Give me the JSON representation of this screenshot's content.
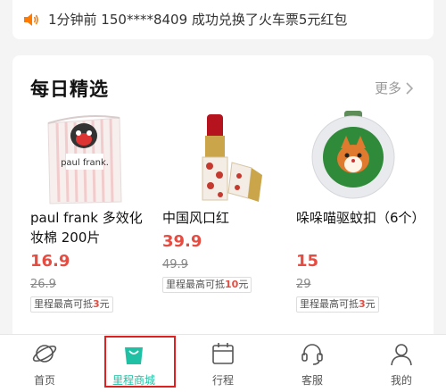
{
  "notice": {
    "text": "1分钟前 150****8409 成功兑换了火车票5元红包"
  },
  "section": {
    "title": "每日精选",
    "more": "更多"
  },
  "products": [
    {
      "name": "paul frank 多效化妆棉 200片",
      "price": "16.9",
      "original_price": "26.9",
      "tag_prefix": "里程最高可抵",
      "tag_amount": "3",
      "tag_suffix": "元",
      "image_brand": "paul frank."
    },
    {
      "name": "中国风口红",
      "price": "39.9",
      "original_price": "49.9",
      "tag_prefix": "里程最高可抵",
      "tag_amount": "10",
      "tag_suffix": "元"
    },
    {
      "name": "哚哚喵驱蚊扣（6个）",
      "price": "15",
      "original_price": "29",
      "tag_prefix": "里程最高可抵",
      "tag_amount": "3",
      "tag_suffix": "元"
    }
  ],
  "tabs": [
    {
      "label": "首页",
      "icon": "home-planet-icon"
    },
    {
      "label": "里程商城",
      "icon": "shopping-bag-icon",
      "active": true
    },
    {
      "label": "行程",
      "icon": "calendar-icon"
    },
    {
      "label": "客服",
      "icon": "headset-icon"
    },
    {
      "label": "我的",
      "icon": "user-icon"
    }
  ],
  "colors": {
    "price": "#e54d42",
    "active_tab": "#1fc0a4",
    "highlight": "#e02020",
    "speaker": "#ff7a00"
  }
}
